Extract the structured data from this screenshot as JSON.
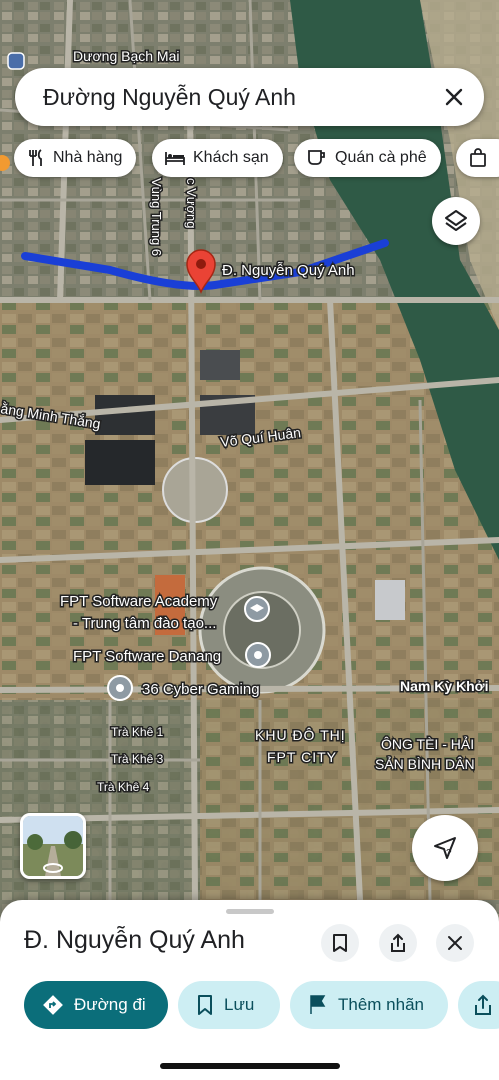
{
  "search": {
    "query": "Đường Nguyễn Quý Anh",
    "clear_icon": "close-icon"
  },
  "chips": [
    {
      "label": "Nhà hàng",
      "icon": "restaurant-icon"
    },
    {
      "label": "Khách sạn",
      "icon": "hotel-icon"
    },
    {
      "label": "Quán cà phê",
      "icon": "coffee-icon"
    },
    {
      "label": "",
      "icon": "shopping-bag-icon"
    }
  ],
  "map": {
    "labels": {
      "bach_mai": "Dương Bạch Mai",
      "vung_trung": "Vùng Trung 6",
      "vuong": "c Vượng",
      "route_label": "Đ. Nguyễn Quý Anh",
      "minh_thang": "ằng Minh Thắng",
      "vo_qui_huan": "Võ Quí Huân",
      "fpt_academy_1": "FPT Software Academy",
      "fpt_academy_2": "- Trung tâm đào tạo...",
      "fpt_danang": "FPT Software Danang",
      "cyber_gaming": "36 Cyber Gaming",
      "nam_ky_khoi": "Nam Kỳ Khởi",
      "tra_khe_1": "Trà Khê 1",
      "tra_khe_3": "Trà Khê 3",
      "tra_khe_4": "Trà Khê 4",
      "khu_do_thi_1": "KHU ĐÔ THỊ",
      "khu_do_thi_2": "FPT CITY",
      "ong_tei_1": "ÔNG TÈI - HẢI",
      "ong_tei_2": "SẢN BÌNH DÂN"
    },
    "colors": {
      "route": "#1a3fd6",
      "pin": "#ea4335",
      "river": "#2f5a46",
      "land": "#9b8f6b"
    }
  },
  "sheet": {
    "title": "Đ. Nguyễn Quý Anh",
    "actions": [
      {
        "label": "Đường đi",
        "icon": "directions-icon"
      },
      {
        "label": "Lưu",
        "icon": "bookmark-icon"
      },
      {
        "label": "Thêm nhãn",
        "icon": "flag-icon"
      },
      {
        "label": "",
        "icon": "share-icon"
      }
    ]
  }
}
